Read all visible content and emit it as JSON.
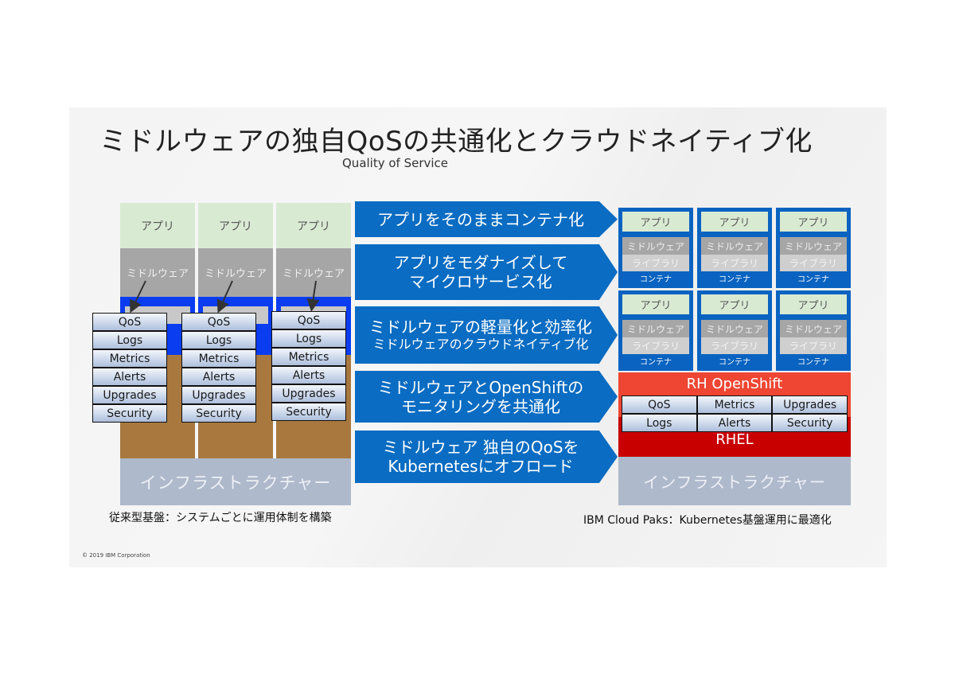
{
  "title": "ミドルウェアの独自QoSの共通化とクラウドネイティブ化",
  "subtitle": "Quality of Service",
  "left": {
    "columns": [
      {
        "app": "アプリ",
        "middleware": "ミドルウェア"
      },
      {
        "app": "アプリ",
        "middleware": "ミドルウェア"
      },
      {
        "app": "アプリ",
        "middleware": "ミドルウェア"
      }
    ],
    "qos_items": [
      "QoS",
      "Logs",
      "Metrics",
      "Alerts",
      "Upgrades",
      "Security"
    ],
    "infrastructure": "インフラストラクチャー",
    "caption": "従来型基盤：システムごとに運用体制を構築"
  },
  "steps": [
    {
      "lines": [
        "アプリをそのままコンテナ化"
      ],
      "size": "big"
    },
    {
      "lines": [
        "アプリをモダナイズして",
        "マイクロサービス化"
      ],
      "size": "big"
    },
    {
      "lines": [
        "ミドルウェアの軽量化と効率化",
        "ミドルウェアのクラウドネイティブ化"
      ],
      "size": "mixed"
    },
    {
      "lines": [
        "ミドルウェアとOpenShiftの",
        "モニタリングを共通化"
      ],
      "size": "big"
    },
    {
      "lines": [
        "ミドルウェア 独自のQoSを",
        "Kubernetesにオフロード"
      ],
      "size": "big"
    }
  ],
  "right": {
    "container": {
      "app": "アプリ",
      "middleware": "ミドルウェア",
      "library": "ライブラリ",
      "label": "コンテナ"
    },
    "openshift": "RH OpenShift",
    "qos_grid": [
      "QoS",
      "Metrics",
      "Upgrades",
      "Logs",
      "Alerts",
      "Security"
    ],
    "rhel": "RHEL",
    "infrastructure": "インフラストラクチャー",
    "caption": "IBM Cloud Paks：Kubernetes基盤運用に最適化"
  },
  "footer": {
    "copyright": "© 2019 IBM Corporation"
  },
  "colors": {
    "chevron": "#0a6cc2",
    "container": "#0a63c0",
    "openshift": "#ee4632",
    "rhel": "#c80000",
    "app": "#d9ead3",
    "middleware": "#a6a6a6",
    "library_blue": "#0a3cf0",
    "os_brown": "#a8783f",
    "infrastructure": "#aeb9cc"
  }
}
